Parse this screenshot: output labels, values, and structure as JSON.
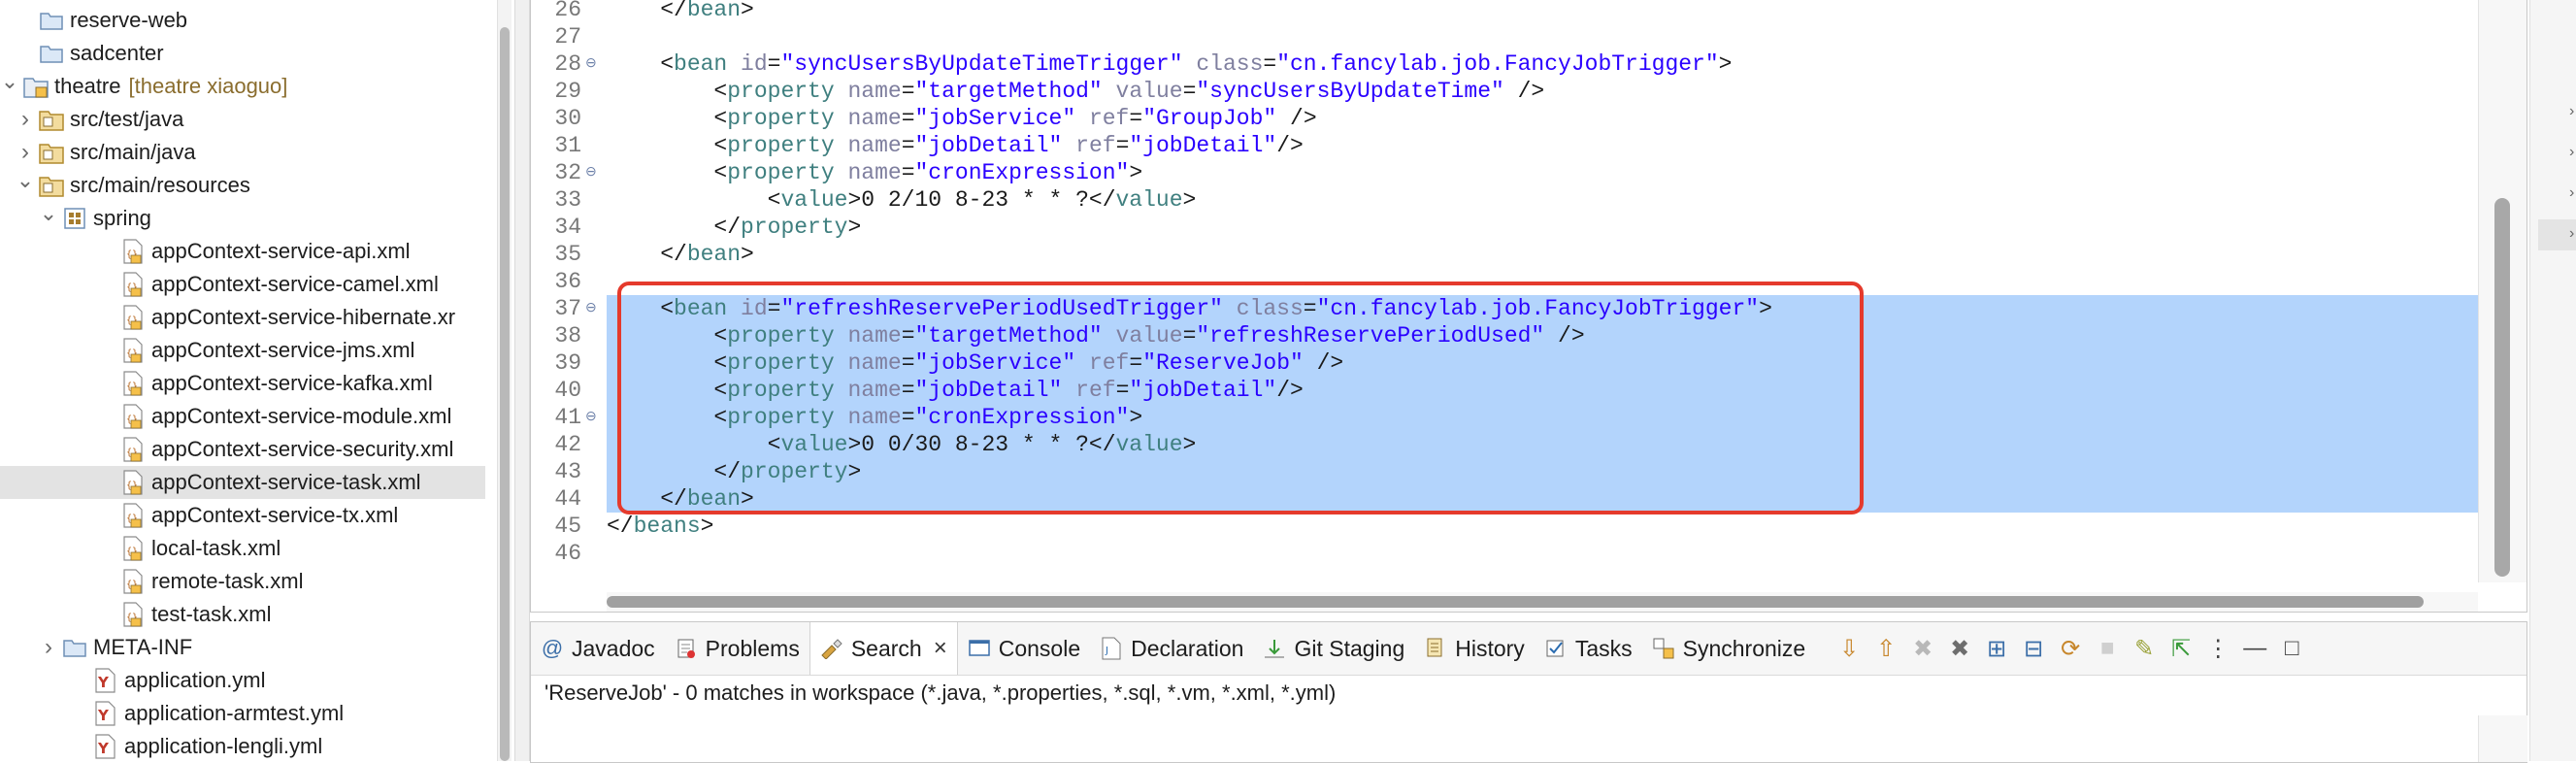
{
  "explorer": {
    "items": [
      {
        "label": "reserve-web",
        "decor": "",
        "icon": "folder-icon"
      },
      {
        "label": "sadcenter",
        "decor": "",
        "icon": "folder-icon"
      },
      {
        "label": "theatre",
        "decor": "[theatre xiaoguo]",
        "icon": "project-icon"
      },
      {
        "label": "src/test/java",
        "decor": "",
        "icon": "package-folder-icon"
      },
      {
        "label": "src/main/java",
        "decor": "",
        "icon": "package-folder-icon"
      },
      {
        "label": "src/main/resources",
        "decor": "",
        "icon": "package-folder-icon"
      },
      {
        "label": "spring",
        "decor": "",
        "icon": "package-icon"
      },
      {
        "label": "appContext-service-api.xml",
        "decor": "",
        "icon": "xml-file-icon"
      },
      {
        "label": "appContext-service-camel.xml",
        "decor": "",
        "icon": "xml-file-icon"
      },
      {
        "label": "appContext-service-hibernate.xr",
        "decor": "",
        "icon": "xml-file-icon"
      },
      {
        "label": "appContext-service-jms.xml",
        "decor": "",
        "icon": "xml-file-icon"
      },
      {
        "label": "appContext-service-kafka.xml",
        "decor": "",
        "icon": "xml-file-icon"
      },
      {
        "label": "appContext-service-module.xml",
        "decor": "",
        "icon": "xml-file-icon"
      },
      {
        "label": "appContext-service-security.xml",
        "decor": "",
        "icon": "xml-file-icon"
      },
      {
        "label": "appContext-service-task.xml",
        "decor": "",
        "icon": "xml-file-icon"
      },
      {
        "label": "appContext-service-tx.xml",
        "decor": "",
        "icon": "xml-file-icon"
      },
      {
        "label": "local-task.xml",
        "decor": "",
        "icon": "xml-file-icon"
      },
      {
        "label": "remote-task.xml",
        "decor": "",
        "icon": "xml-file-icon"
      },
      {
        "label": "test-task.xml",
        "decor": "",
        "icon": "xml-file-icon"
      },
      {
        "label": "META-INF",
        "decor": "",
        "icon": "folder-icon"
      },
      {
        "label": "application.yml",
        "decor": "",
        "icon": "yaml-file-icon"
      },
      {
        "label": "application-armtest.yml",
        "decor": "",
        "icon": "yaml-file-icon"
      },
      {
        "label": "application-lengli.yml",
        "decor": "",
        "icon": "yaml-file-icon"
      }
    ],
    "selected": "appContext-service-task.xml"
  },
  "editor": {
    "lines": [
      {
        "n": "26",
        "tokens": [
          [
            "p",
            "    </"
          ],
          [
            "t",
            "bean"
          ],
          [
            "p",
            ">"
          ]
        ]
      },
      {
        "n": "27",
        "tokens": []
      },
      {
        "n": "28",
        "fold": true,
        "tokens": [
          [
            "p",
            "    <"
          ],
          [
            "t",
            "bean"
          ],
          [
            "p",
            " "
          ],
          [
            "a",
            "id"
          ],
          [
            "p",
            "="
          ],
          [
            "v",
            "\"syncUsersByUpdateTimeTrigger\""
          ],
          [
            "p",
            " "
          ],
          [
            "a",
            "class"
          ],
          [
            "p",
            "="
          ],
          [
            "v",
            "\"cn.fancylab.job.FancyJobTrigger\""
          ],
          [
            "p",
            ">"
          ]
        ]
      },
      {
        "n": "29",
        "tokens": [
          [
            "p",
            "        <"
          ],
          [
            "t",
            "property"
          ],
          [
            "p",
            " "
          ],
          [
            "a",
            "name"
          ],
          [
            "p",
            "="
          ],
          [
            "v",
            "\"targetMethod\""
          ],
          [
            "p",
            " "
          ],
          [
            "a",
            "value"
          ],
          [
            "p",
            "="
          ],
          [
            "v",
            "\"syncUsersByUpdateTime\""
          ],
          [
            "p",
            " />"
          ]
        ]
      },
      {
        "n": "30",
        "tokens": [
          [
            "p",
            "        <"
          ],
          [
            "t",
            "property"
          ],
          [
            "p",
            " "
          ],
          [
            "a",
            "name"
          ],
          [
            "p",
            "="
          ],
          [
            "v",
            "\"jobService\""
          ],
          [
            "p",
            " "
          ],
          [
            "a",
            "ref"
          ],
          [
            "p",
            "="
          ],
          [
            "v",
            "\"GroupJob\""
          ],
          [
            "p",
            " />"
          ]
        ]
      },
      {
        "n": "31",
        "tokens": [
          [
            "p",
            "        <"
          ],
          [
            "t",
            "property"
          ],
          [
            "p",
            " "
          ],
          [
            "a",
            "name"
          ],
          [
            "p",
            "="
          ],
          [
            "v",
            "\"jobDetail\""
          ],
          [
            "p",
            " "
          ],
          [
            "a",
            "ref"
          ],
          [
            "p",
            "="
          ],
          [
            "v",
            "\"jobDetail\""
          ],
          [
            "p",
            "/>"
          ]
        ]
      },
      {
        "n": "32",
        "fold": true,
        "tokens": [
          [
            "p",
            "        <"
          ],
          [
            "t",
            "property"
          ],
          [
            "p",
            " "
          ],
          [
            "a",
            "name"
          ],
          [
            "p",
            "="
          ],
          [
            "v",
            "\"cronExpression\""
          ],
          [
            "p",
            ">"
          ]
        ]
      },
      {
        "n": "33",
        "tokens": [
          [
            "p",
            "            <"
          ],
          [
            "t",
            "value"
          ],
          [
            "p",
            ">0 2/10 8-23 * * ?</"
          ],
          [
            "t",
            "value"
          ],
          [
            "p",
            ">"
          ]
        ]
      },
      {
        "n": "34",
        "tokens": [
          [
            "p",
            "        </"
          ],
          [
            "t",
            "property"
          ],
          [
            "p",
            ">"
          ]
        ]
      },
      {
        "n": "35",
        "tokens": [
          [
            "p",
            "    </"
          ],
          [
            "t",
            "bean"
          ],
          [
            "p",
            ">"
          ]
        ]
      },
      {
        "n": "36",
        "tokens": []
      },
      {
        "n": "37",
        "fold": true,
        "sel": true,
        "tokens": [
          [
            "p",
            "    <"
          ],
          [
            "t",
            "bean"
          ],
          [
            "p",
            " "
          ],
          [
            "a",
            "id"
          ],
          [
            "p",
            "="
          ],
          [
            "v",
            "\"refreshReservePeriodUsedTrigger\""
          ],
          [
            "p",
            " "
          ],
          [
            "a",
            "class"
          ],
          [
            "p",
            "="
          ],
          [
            "v",
            "\"cn.fancylab.job.FancyJobTrigger\""
          ],
          [
            "p",
            ">"
          ]
        ]
      },
      {
        "n": "38",
        "sel": true,
        "tokens": [
          [
            "p",
            "        <"
          ],
          [
            "t",
            "property"
          ],
          [
            "p",
            " "
          ],
          [
            "a",
            "name"
          ],
          [
            "p",
            "="
          ],
          [
            "v",
            "\"targetMethod\""
          ],
          [
            "p",
            " "
          ],
          [
            "a",
            "value"
          ],
          [
            "p",
            "="
          ],
          [
            "v",
            "\"refreshReservePeriodUsed\""
          ],
          [
            "p",
            " />"
          ]
        ]
      },
      {
        "n": "39",
        "sel": true,
        "tokens": [
          [
            "p",
            "        <"
          ],
          [
            "t",
            "property"
          ],
          [
            "p",
            " "
          ],
          [
            "a",
            "name"
          ],
          [
            "p",
            "="
          ],
          [
            "v",
            "\"jobService\""
          ],
          [
            "p",
            " "
          ],
          [
            "a",
            "ref"
          ],
          [
            "p",
            "="
          ],
          [
            "v",
            "\"ReserveJob\""
          ],
          [
            "p",
            " />"
          ]
        ]
      },
      {
        "n": "40",
        "sel": true,
        "tokens": [
          [
            "p",
            "        <"
          ],
          [
            "t",
            "property"
          ],
          [
            "p",
            " "
          ],
          [
            "a",
            "name"
          ],
          [
            "p",
            "="
          ],
          [
            "v",
            "\"jobDetail\""
          ],
          [
            "p",
            " "
          ],
          [
            "a",
            "ref"
          ],
          [
            "p",
            "="
          ],
          [
            "v",
            "\"jobDetail\""
          ],
          [
            "p",
            "/>"
          ]
        ]
      },
      {
        "n": "41",
        "fold": true,
        "sel": true,
        "tokens": [
          [
            "p",
            "        <"
          ],
          [
            "t",
            "property"
          ],
          [
            "p",
            " "
          ],
          [
            "a",
            "name"
          ],
          [
            "p",
            "="
          ],
          [
            "v",
            "\"cronExpression\""
          ],
          [
            "p",
            ">"
          ]
        ]
      },
      {
        "n": "42",
        "sel": true,
        "tokens": [
          [
            "p",
            "            <"
          ],
          [
            "t",
            "value"
          ],
          [
            "p",
            ">0 0/30 8-23 * * ?</"
          ],
          [
            "t",
            "value"
          ],
          [
            "p",
            ">"
          ]
        ]
      },
      {
        "n": "43",
        "sel": true,
        "tokens": [
          [
            "p",
            "        </"
          ],
          [
            "t",
            "property"
          ],
          [
            "p",
            ">"
          ]
        ]
      },
      {
        "n": "44",
        "sel": true,
        "tokens": [
          [
            "p",
            "    </"
          ],
          [
            "t",
            "bean"
          ],
          [
            "p",
            ">"
          ]
        ]
      },
      {
        "n": "45",
        "tokens": [
          [
            "p",
            "</"
          ],
          [
            "t",
            "beans"
          ],
          [
            "p",
            ">"
          ]
        ]
      },
      {
        "n": "46",
        "tokens": []
      }
    ]
  },
  "bottom_panel": {
    "tabs": [
      {
        "label": "Javadoc",
        "icon": "at-icon"
      },
      {
        "label": "Problems",
        "icon": "problems-icon"
      },
      {
        "label": "Search",
        "icon": "search-flashlight-icon",
        "active": true
      },
      {
        "label": "Console",
        "icon": "console-icon"
      },
      {
        "label": "Declaration",
        "icon": "declaration-icon"
      },
      {
        "label": "Git Staging",
        "icon": "git-staging-icon"
      },
      {
        "label": "History",
        "icon": "history-icon"
      },
      {
        "label": "Tasks",
        "icon": "tasks-icon"
      },
      {
        "label": "Synchronize",
        "icon": "synchronize-icon"
      }
    ],
    "search_summary": "'ReserveJob' - 0 matches in workspace (*.java, *.properties, *.sql, *.vm, *.xml, *.yml)"
  },
  "colors": {
    "selection": "#b3d4fc",
    "highlight_box": "#e53a2c",
    "tag": "#3f7f7f",
    "attribute": "#7f7f9f",
    "value": "#2a00ff"
  }
}
